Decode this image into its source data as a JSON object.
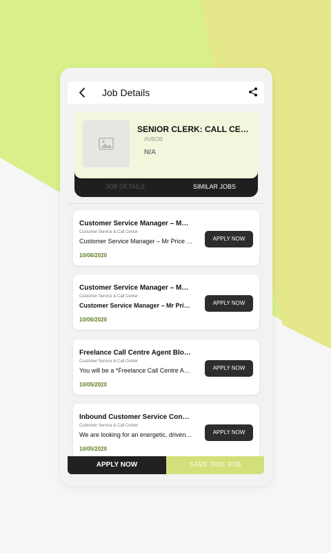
{
  "colors": {
    "accent_green": "#d3e07a",
    "dark": "#212121",
    "date_green": "#5f7d1e"
  },
  "topbar": {
    "title": "Job Details",
    "back_icon": "chevron-left-icon",
    "share_icon": "share-icon"
  },
  "job": {
    "title": "SENIOR CLERK: CALL CENTRE",
    "company": "AVBOB",
    "salary": "N/A",
    "logo_icon": "image-placeholder-icon"
  },
  "tabs": [
    {
      "label": "JOB DETAILS",
      "active": false
    },
    {
      "label": "SIMILAR JOBS",
      "active": true
    }
  ],
  "similar_jobs": [
    {
      "title": "Customer Service Manager – Mr Price Head Office",
      "category": "Customer Service & Call Center",
      "description": "Customer Service Manager – Mr Price Head Office",
      "date": "10/06/2020",
      "apply_label": "APPLY NOW"
    },
    {
      "title": "Customer Service Manager – Mr Price Head Office",
      "category": "Customer Service & Call Center",
      "description": "Customer Service Manager – Mr Price Head Office",
      "date": "10/06/2020",
      "apply_label": "APPLY NOW"
    },
    {
      "title": "Freelance Call Centre Agent Bloemfontein",
      "category": "Customer Service & Call Center",
      "description": "You will be a *Freelance Call Centre Agent*",
      "date": "10/05/2020",
      "apply_label": "APPLY NOW"
    },
    {
      "title": "Inbound Customer Service Consultant",
      "category": "Customer Service & Call Center",
      "description": "We are looking for an energetic, driven person",
      "date": "10/05/2020",
      "apply_label": "APPLY NOW"
    }
  ],
  "bottom": {
    "apply_now": "APPLY NOW",
    "save_job": "SAVE THIS JOB"
  }
}
